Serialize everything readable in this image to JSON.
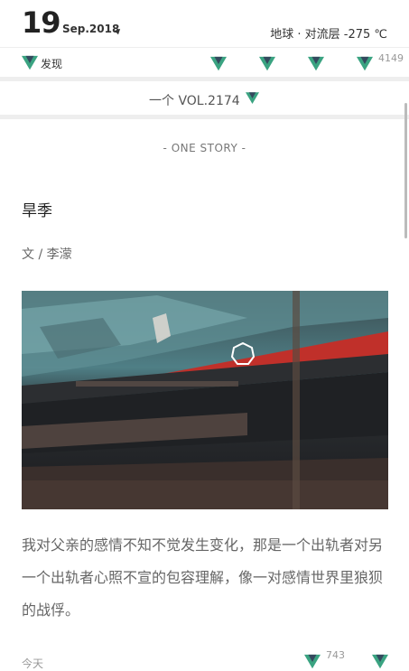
{
  "header": {
    "day": "19",
    "month_year": "Sep.2018",
    "weather": "地球 · 对流层 -275  ℃"
  },
  "nav": {
    "discover_label": "发现",
    "count": "4149"
  },
  "volume": {
    "label": "一个 VOL.2174"
  },
  "article": {
    "section": "- ONE STORY -",
    "title": "旱季",
    "author": "文 / 李濛",
    "excerpt": "我对父亲的感情不知不觉发生变化，那是一个出轨者对另一个出轨者心照不宣的包容理解，像一对感情世界里狼狈的战俘。",
    "footer_label": "今天",
    "likes": "743"
  },
  "colors": {
    "accent_green": "#3aa381",
    "accent_dark": "#34495e"
  }
}
